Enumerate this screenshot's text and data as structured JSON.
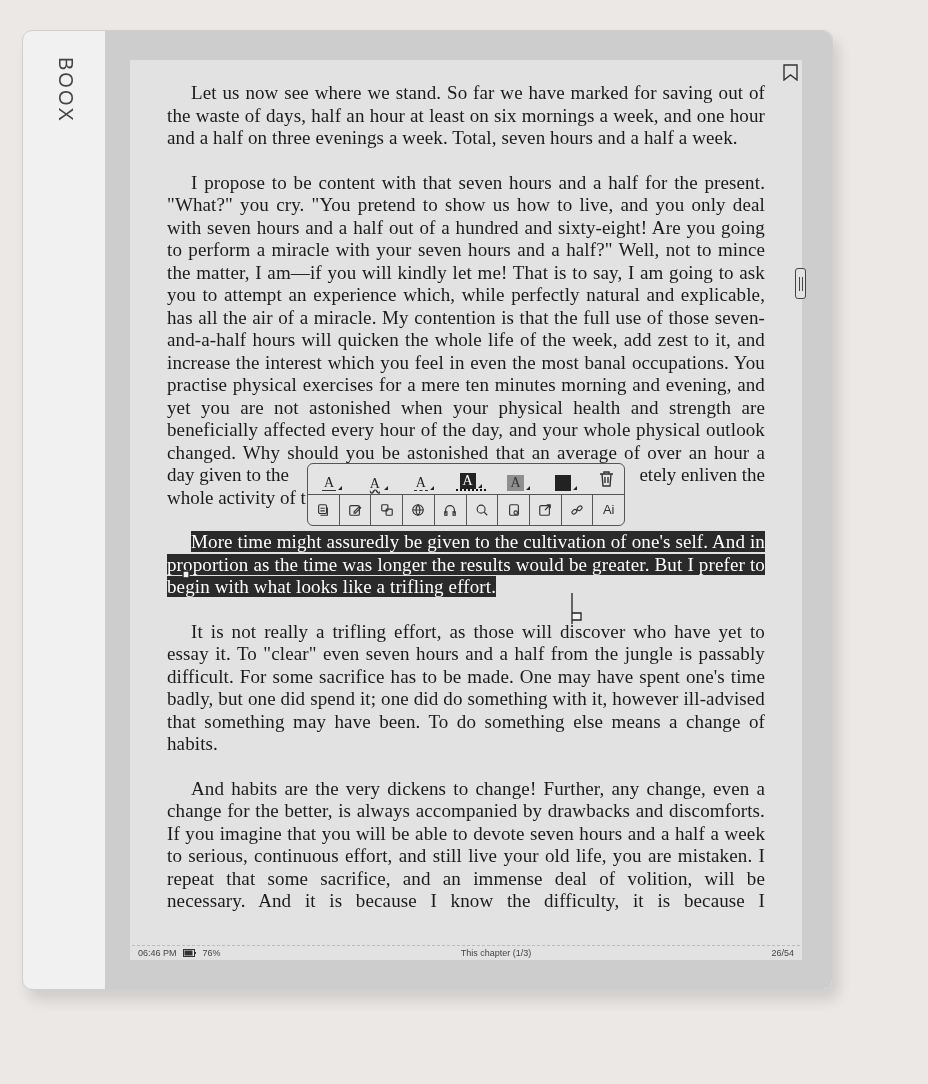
{
  "device": {
    "brand": "BOOX"
  },
  "page": {
    "paragraphs": [
      {
        "kind": "plain",
        "text": "Let us now see where we stand. So far we have marked for saving out of the waste of days, half an hour at least on six mornings a week, and one hour and a half on three evenings a week. Total, seven hours and a half a week."
      },
      {
        "kind": "covered",
        "text": "I propose to be content with that seven hours and a half for the present. \"What?\" you cry. \"You pretend to show us how to live, and you only deal with seven hours and a half out of a hundred and sixty-eight! Are you going to perform a miracle with your seven hours and a half?\" Well, not to mince the matter, I am—if you will kindly let me! That is to say, I am going to ask you to attempt an experience which, while perfectly natural and explicable, has all the air of a miracle. My contention is that the full use of those seven-and-a-half hours will quicken the whole life of the week, add zest to it, and increase the interest which you feel in even the most banal occupations. You practise physical exercises for a mere ten minutes morning and evening, and yet you are not astonished when your physical health and strength are beneficially affected every hour of the day, and your whole physical outlook changed. Why should you be astonished that an average of over an hour a",
        "left_fragment": "day given to the",
        "right_fragment": "etely enliven the",
        "last_fragment": "whole activity of t"
      },
      {
        "kind": "selected",
        "text": "More time might assuredly be given to the cultivation of one's self. And in proportion as the time was longer the results would be greater. But I prefer to begin with what looks like a trifling effort."
      },
      {
        "kind": "plain",
        "text": "It is not really a trifling effort, as those will discover who have yet to essay it. To \"clear\" even seven hours and a half from the jungle is passably difficult. For some sacrifice has to be made. One may have spent one's time badly, but one did spend it; one did do something with it, however ill-advised that something may have been. To do something else means a change of habits."
      },
      {
        "kind": "cut",
        "text": "And habits are the very dickens to change! Further, any change, even a change for the better, is always accompanied by drawbacks and discomforts. If you imagine that you will be able to devote seven hours and a half a week to serious, continuous effort, and still live your old life, you are mistaken. I repeat that some sacrifice, and an immense deal of volition, will be necessary. And it is because I know the difficulty, it is because I"
      }
    ]
  },
  "toolbar": {
    "styles": [
      {
        "kind": "underline",
        "label": "A",
        "selected": false
      },
      {
        "kind": "wavy",
        "label": "A",
        "selected": false
      },
      {
        "kind": "dashed",
        "label": "A",
        "selected": false
      },
      {
        "kind": "dark",
        "label": "A",
        "selected": true
      },
      {
        "kind": "gray",
        "label": "A",
        "selected": false
      },
      {
        "kind": "block",
        "selected": false
      }
    ],
    "ai_label": "Ai"
  },
  "status_bar": {
    "time": "06:46 PM",
    "battery": "76%",
    "chapter": "This chapter (1/3)",
    "page": "26/54"
  }
}
